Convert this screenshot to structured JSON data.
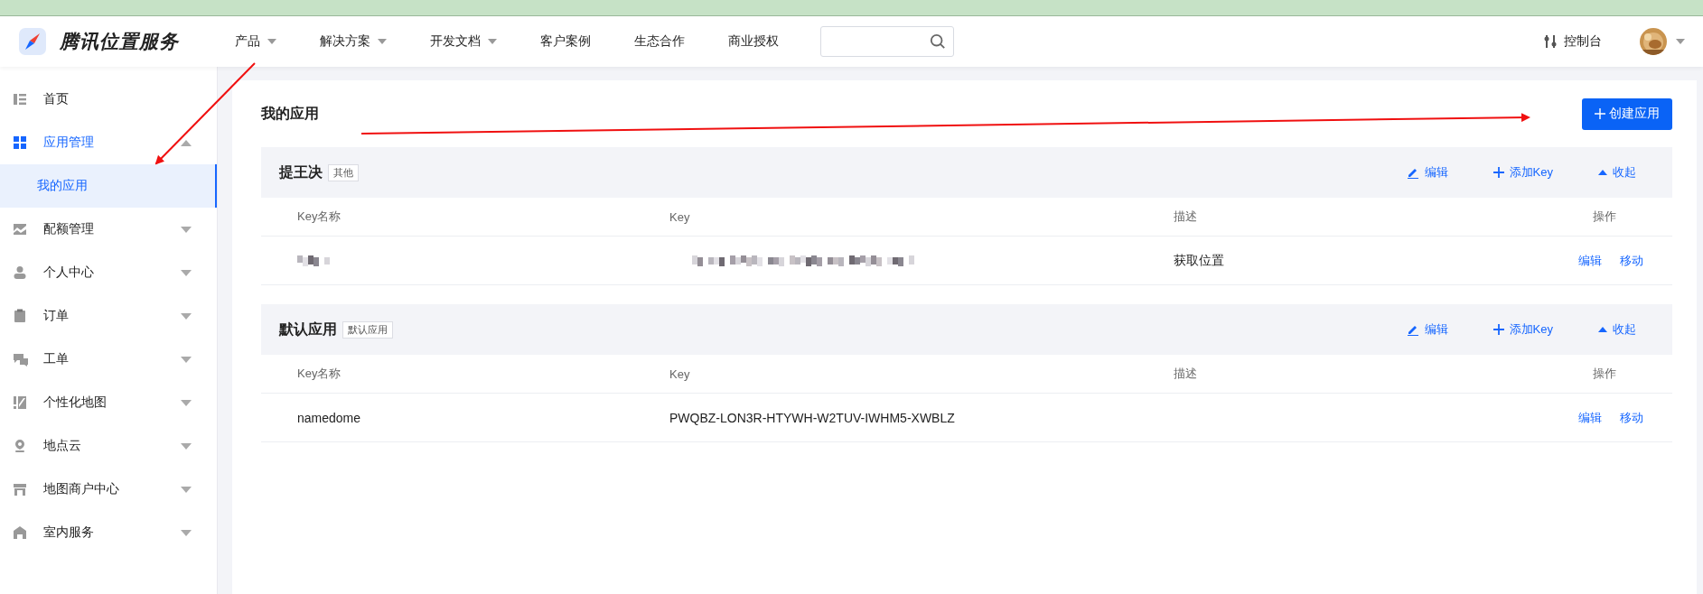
{
  "header": {
    "logo_text": "腾讯位置服务",
    "nav": [
      {
        "label": "产品",
        "has_menu": true
      },
      {
        "label": "解决方案",
        "has_menu": true
      },
      {
        "label": "开发文档",
        "has_menu": true
      },
      {
        "label": "客户案例",
        "has_menu": false
      },
      {
        "label": "生态合作",
        "has_menu": false
      },
      {
        "label": "商业授权",
        "has_menu": false
      }
    ],
    "console_label": "控制台"
  },
  "sidebar": {
    "items": [
      {
        "label": "首页",
        "kind": "link",
        "selected": false
      },
      {
        "label": "应用管理",
        "kind": "group",
        "selected": true,
        "expanded": true,
        "children": [
          {
            "label": "我的应用",
            "selected": true
          }
        ]
      },
      {
        "label": "配额管理",
        "kind": "group",
        "selected": false,
        "expanded": false
      },
      {
        "label": "个人中心",
        "kind": "group",
        "selected": false,
        "expanded": false
      },
      {
        "label": "订单",
        "kind": "group",
        "selected": false,
        "expanded": false
      },
      {
        "label": "工单",
        "kind": "group",
        "selected": false,
        "expanded": false
      },
      {
        "label": "个性化地图",
        "kind": "group",
        "selected": false,
        "expanded": false
      },
      {
        "label": "地点云",
        "kind": "group",
        "selected": false,
        "expanded": false
      },
      {
        "label": "地图商户中心",
        "kind": "group",
        "selected": false,
        "expanded": false
      },
      {
        "label": "室内服务",
        "kind": "group",
        "selected": false,
        "expanded": false
      }
    ]
  },
  "page": {
    "title": "我的应用",
    "create_button": "创建应用",
    "apps": [
      {
        "name": "提王决",
        "tag": "其他",
        "edit": "编辑",
        "add_key": "添加Key",
        "collapse": "收起",
        "expanded": true,
        "columns": [
          "Key名称",
          "Key",
          "描述",
          "操作"
        ],
        "rows": [
          {
            "redacted": true,
            "description": "获取位置",
            "actions": [
              "编辑",
              "移动"
            ]
          }
        ]
      },
      {
        "name": "默认应用",
        "tag": "默认应用",
        "edit": "编辑",
        "add_key": "添加Key",
        "collapse": "收起",
        "expanded": true,
        "columns": [
          "Key名称",
          "Key",
          "描述",
          "操作"
        ],
        "rows": [
          {
            "redacted": false,
            "key_name": "namedome",
            "key": "PWQBZ-LON3R-HTYWH-W2TUV-IWHM5-XWBLZ",
            "actions": [
              "编辑",
              "移动"
            ]
          }
        ]
      }
    ]
  }
}
